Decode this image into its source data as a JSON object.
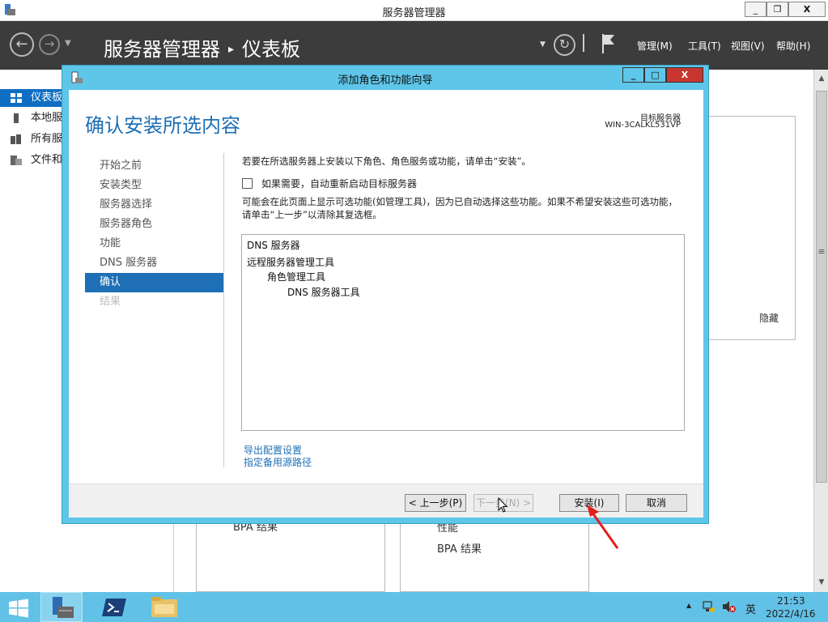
{
  "outer_window": {
    "title": "服务器管理器",
    "buttons": {
      "minimize": "_",
      "restore": "❐",
      "close": "X"
    }
  },
  "header": {
    "breadcrumb_app": "服务器管理器",
    "breadcrumb_sep": "▸",
    "breadcrumb_page": "仪表板",
    "menus": {
      "manage": "管理(M)",
      "tools": "工具(T)",
      "view": "视图(V)",
      "help": "帮助(H)"
    },
    "back_icon": "←",
    "forward_icon": "→",
    "refresh_icon": "↻"
  },
  "left_nav": {
    "items": [
      {
        "label": "仪表板",
        "icon": "dashboard-icon"
      },
      {
        "label": "本地服务器",
        "icon": "server-icon"
      },
      {
        "label": "所有服务器",
        "icon": "servers-icon"
      },
      {
        "label": "文件和存储服务",
        "icon": "storage-icon"
      }
    ]
  },
  "dashboard": {
    "hide_label": "隐藏",
    "tile1_text": "BPA 结果",
    "tile2_line1": "性能",
    "tile2_line2": "BPA 结果"
  },
  "dialog": {
    "title": "添加角色和功能向导",
    "heading": "确认安装所选内容",
    "target_label": "目标服务器",
    "target_name": "WIN-3CALKL531VP",
    "steps": [
      {
        "label": "开始之前",
        "state": "normal"
      },
      {
        "label": "安装类型",
        "state": "normal"
      },
      {
        "label": "服务器选择",
        "state": "normal"
      },
      {
        "label": "服务器角色",
        "state": "normal"
      },
      {
        "label": "功能",
        "state": "normal"
      },
      {
        "label": "DNS 服务器",
        "state": "normal"
      },
      {
        "label": "确认",
        "state": "active"
      },
      {
        "label": "结果",
        "state": "disabled"
      }
    ],
    "instruction": "若要在所选服务器上安装以下角色、角色服务或功能，请单击“安装”。",
    "restart_label": "如果需要，自动重新启动目标服务器",
    "optional_note": "可能会在此页面上显示可选功能(如管理工具)，因为已自动选择这些功能。如果不希望安装这些可选功能，请单击“上一步”以清除其复选框。",
    "features": [
      {
        "label": "DNS 服务器",
        "level": 0
      },
      {
        "label": "远程服务器管理工具",
        "level": 0
      },
      {
        "label": "角色管理工具",
        "level": 1
      },
      {
        "label": "DNS 服务器工具",
        "level": 2
      }
    ],
    "export_link": "导出配置设置",
    "alt_source_link": "指定备用源路径",
    "buttons": {
      "prev": "< 上一步(P)",
      "next": "下一步(N) >",
      "install": "安装(I)",
      "cancel": "取消"
    }
  },
  "taskbar": {
    "time": "21:53",
    "date": "2022/4/16",
    "ime": "英"
  }
}
